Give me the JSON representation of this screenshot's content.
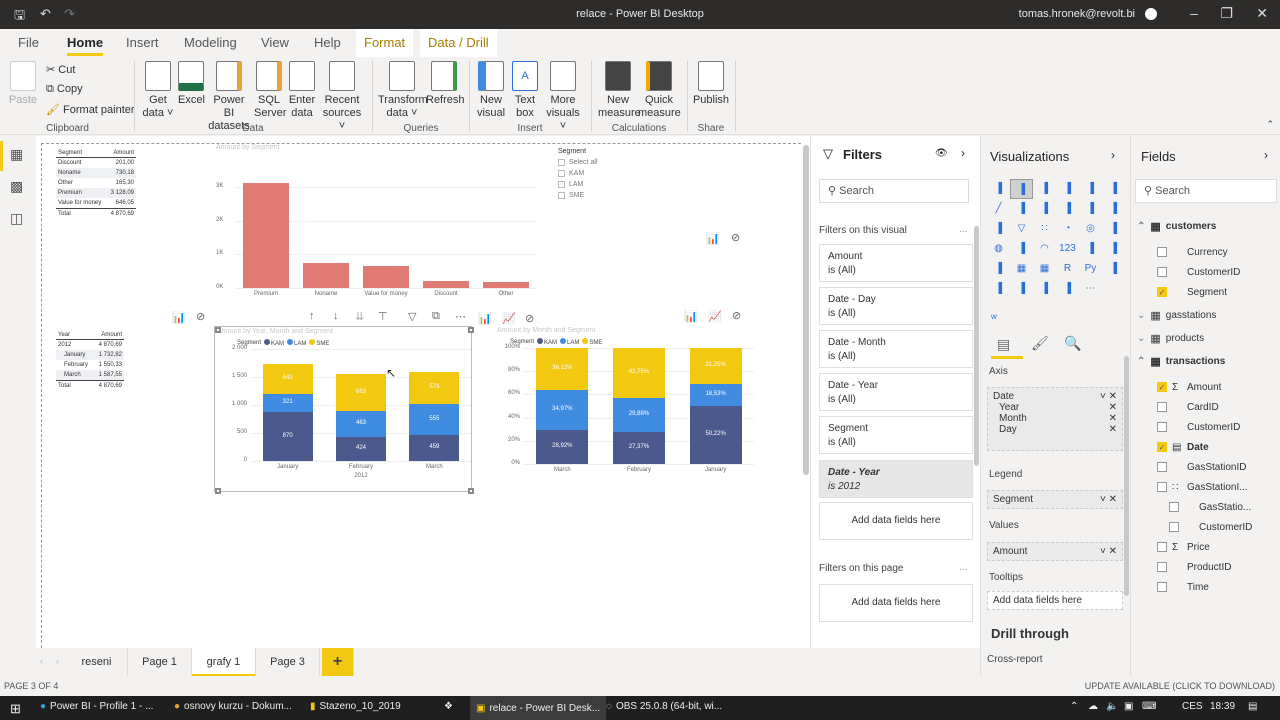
{
  "window": {
    "title": "relace - Power BI Desktop",
    "user": "tomas.hronek@revolt.bi"
  },
  "tabs": {
    "file": "File",
    "home": "Home",
    "insert": "Insert",
    "modeling": "Modeling",
    "view": "View",
    "help": "Help",
    "format": "Format",
    "data_drill": "Data / Drill"
  },
  "ribbon": {
    "paste": "Paste",
    "cut": "Cut",
    "copy": "Copy",
    "format_painter": "Format painter",
    "clipboard": "Clipboard",
    "get_data": "Get data",
    "excel": "Excel",
    "pbi_datasets": "Power BI datasets",
    "sql_server": "SQL Server",
    "enter_data": "Enter data",
    "recent_sources": "Recent sources",
    "data": "Data",
    "transform_data": "Transform data",
    "refresh": "Refresh",
    "queries": "Queries",
    "new_visual": "New visual",
    "text_box": "Text box",
    "more_visuals": "More visuals",
    "insert": "Insert",
    "new_measure": "New measure",
    "quick_measure": "Quick measure",
    "calculations": "Calculations",
    "publish": "Publish",
    "share": "Share"
  },
  "canvas": {
    "segment_table": {
      "headers": [
        "Segment",
        "Amount"
      ],
      "rows": [
        [
          "Discount",
          "201,00"
        ],
        [
          "Noname",
          "730,18"
        ],
        [
          "Other",
          "165,30"
        ],
        [
          "Premium",
          "3 128,09"
        ],
        [
          "Value for money",
          "646,05"
        ]
      ],
      "total": [
        "Total",
        "4 870,69"
      ]
    },
    "year_table": {
      "headers": [
        "Year",
        "Amount"
      ],
      "rows": [
        [
          "2012",
          "4 870,69"
        ],
        [
          "January",
          "1 732,82"
        ],
        [
          "February",
          "1 550,33"
        ],
        [
          "March",
          "1 587,55"
        ]
      ],
      "total": [
        "Total",
        "4 870,69"
      ]
    },
    "slicer": {
      "title": "Segment",
      "items": [
        "Select all",
        "KAM",
        "LAM",
        "SME"
      ]
    }
  },
  "chart_data": [
    {
      "type": "bar",
      "title": "Amount by Segment",
      "categories": [
        "Premium",
        "Noname",
        "Value for money",
        "Discount",
        "Other"
      ],
      "values": [
        3128.09,
        730.18,
        646.05,
        201.0,
        165.3
      ],
      "ylim": [
        0,
        3500
      ],
      "yticks": [
        "0K",
        "1K",
        "2K",
        "3K"
      ],
      "ytick_values": [
        0,
        1000,
        2000,
        3000
      ],
      "color": "#e07a74",
      "grid": true
    },
    {
      "type": "bar",
      "stacked": true,
      "title": "Amount by Year, Month and Segment",
      "legend_title": "Segment",
      "legend": "top-left",
      "categories": [
        "January",
        "February",
        "March"
      ],
      "x_group": "2012",
      "series": [
        {
          "name": "KAM",
          "color": "#4a5a8c",
          "values": [
            870,
            424,
            459
          ]
        },
        {
          "name": "LAM",
          "color": "#3f8ce0",
          "values": [
            321,
            463,
            555
          ]
        },
        {
          "name": "SME",
          "color": "#f2c811",
          "values": [
            542,
            663,
            573
          ]
        }
      ],
      "ylim": [
        0,
        2000
      ],
      "yticks": [
        "0",
        "500",
        "1 000",
        "1 500",
        "2 000"
      ],
      "ytick_values": [
        0,
        500,
        1000,
        1500,
        2000
      ]
    },
    {
      "type": "bar",
      "stacked": true,
      "percent": true,
      "title": "Amount by Month and Segment",
      "legend_title": "Segment",
      "legend": "top-left",
      "categories": [
        "March",
        "February",
        "January"
      ],
      "series": [
        {
          "name": "KAM",
          "color": "#4a5a8c",
          "values": [
            28.92,
            27.37,
            50.22
          ],
          "labels": [
            "28,92%",
            "27,37%",
            "50,22%"
          ]
        },
        {
          "name": "LAM",
          "color": "#3f8ce0",
          "values": [
            34.97,
            29.88,
            18.53
          ],
          "labels": [
            "34,97%",
            "29,88%",
            "18,53%"
          ]
        },
        {
          "name": "SME",
          "color": "#f2c811",
          "values": [
            36.12,
            42.75,
            31.25
          ],
          "labels": [
            "36,12%",
            "42,75%",
            "31,25%"
          ]
        }
      ],
      "ylim": [
        0,
        100
      ],
      "yticks": [
        "0%",
        "20%",
        "40%",
        "60%",
        "80%",
        "100%"
      ],
      "ytick_values": [
        0,
        20,
        40,
        60,
        80,
        100
      ]
    }
  ],
  "pages": {
    "tabs": [
      "reseni",
      "Page 1",
      "grafy 1",
      "Page 3"
    ],
    "active": "grafy 1",
    "add": "+"
  },
  "status": {
    "page": "PAGE 3 OF 4",
    "update": "UPDATE AVAILABLE (CLICK TO DOWNLOAD)"
  },
  "filters": {
    "title": "Filters",
    "search": "Search",
    "on_visual": "Filters on this visual",
    "on_page": "Filters on this page",
    "more": "...",
    "cards": [
      {
        "name": "Amount",
        "state": "is (All)"
      },
      {
        "name": "Date - Day",
        "state": "is (All)"
      },
      {
        "name": "Date - Month",
        "state": "is (All)"
      },
      {
        "name": "Date - Year",
        "state": "is (All)"
      },
      {
        "name": "Segment",
        "state": "is (All)"
      }
    ],
    "active_card": {
      "name": "Date - Year",
      "state": "is 2012"
    },
    "add": "Add data fields here"
  },
  "visualizations": {
    "title": "Visualizations",
    "axis": "Axis",
    "axis_field": "Date",
    "axis_sub": [
      "Year",
      "Month",
      "Day"
    ],
    "legend": "Legend",
    "legend_field": "Segment",
    "values": "Values",
    "values_field": "Amount",
    "tooltips": "Tooltips",
    "tooltips_add": "Add data fields here",
    "drill": "Drill through",
    "cross_report": "Cross-report",
    "icons": [
      "stacked-bar",
      "stacked-column",
      "clustered-bar",
      "clustered-column",
      "100-bar",
      "100-column",
      "line",
      "area",
      "stacked-area",
      "line-column",
      "line-clustered",
      "ribbon",
      "waterfall",
      "funnel",
      "scatter",
      "pie",
      "donut",
      "treemap",
      "map",
      "filled-map",
      "gauge",
      "card",
      "multirow-card",
      "kpi",
      "slicer",
      "table",
      "matrix",
      "R",
      "Py",
      "key-influencers",
      "decomposition-tree",
      "qa",
      "smart-narrative",
      "paginated",
      "more"
    ]
  },
  "fields": {
    "title": "Fields",
    "search": "Search",
    "tables": [
      {
        "name": "customers",
        "expanded": true,
        "items": [
          {
            "name": "Currency",
            "checked": false
          },
          {
            "name": "CustomerID",
            "checked": false
          },
          {
            "name": "Segment",
            "checked": true
          }
        ]
      },
      {
        "name": "gasstations",
        "expanded": false
      },
      {
        "name": "products",
        "expanded": false
      },
      {
        "name": "transactions",
        "expanded": true,
        "items": [
          {
            "name": "Amount",
            "checked": true,
            "sigma": true
          },
          {
            "name": "CardID",
            "checked": false
          },
          {
            "name": "CustomerID",
            "checked": false
          },
          {
            "name": "Date",
            "checked": true,
            "bold": true
          },
          {
            "name": "GasStationID",
            "checked": false
          },
          {
            "name": "GasStationI...",
            "checked": false,
            "hierarchy": true
          },
          {
            "name": "GasStatio...",
            "checked": false,
            "indent": true
          },
          {
            "name": "CustomerID",
            "checked": false,
            "indent": true
          },
          {
            "name": "Price",
            "checked": false,
            "sigma": true
          },
          {
            "name": "ProductID",
            "checked": false
          },
          {
            "name": "Time",
            "checked": false
          }
        ]
      }
    ]
  },
  "taskbar": {
    "items": [
      "Power BI - Profile 1 - ...",
      "osnovy kurzu - Dokum...",
      "Stazeno_10_2019",
      "relace - Power BI Desk...",
      "OBS 25.0.8 (64-bit, wi..."
    ],
    "lang": "CES",
    "time": "18:39"
  }
}
